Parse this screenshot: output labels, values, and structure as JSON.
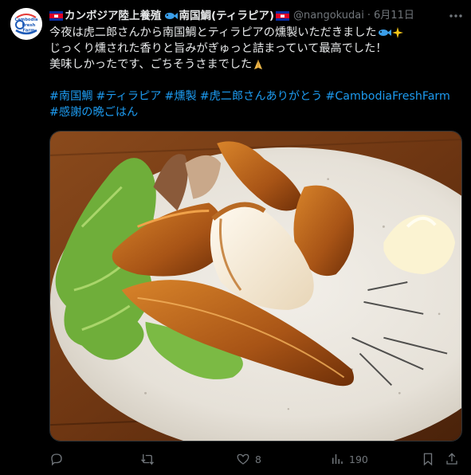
{
  "author": {
    "name": "カンボジア陸上養殖",
    "name_suffix": "南国鯛(ティラピア)",
    "handle": "@nangokudai",
    "separator": "·",
    "date": "6月11日",
    "avatar_text": [
      "Cambodia",
      "Fresh",
      "Farm"
    ]
  },
  "post": {
    "line1": "今夜は虎二郎さんから南国鯛とティラピアの燻製いただきました",
    "line2": "じっくり燻された香りと旨みがぎゅっと詰まっていて最高でした！",
    "line3": "美味しかったです、ごちそうさまでした",
    "hashtags_line1": [
      "#南国鯛",
      "#ティラピア",
      "#燻製",
      "#虎二郎さんありがとう",
      "#CambodiaFreshFarm"
    ],
    "hashtags_line2": [
      "#感謝の晩ごはん"
    ]
  },
  "actions": {
    "reply_count": "",
    "retweet_count": "",
    "like_count": "8",
    "views_count": "190"
  },
  "colors": {
    "background": "#000000",
    "text": "#e7e9ea",
    "muted": "#71767b",
    "link": "#1d9bf0"
  },
  "icons": [
    "cambodia-flag-icon",
    "fish-icon",
    "sparkles-icon",
    "folded-hands-icon",
    "more-icon",
    "reply-icon",
    "retweet-icon",
    "like-icon",
    "views-icon",
    "bookmark-icon",
    "share-icon"
  ]
}
